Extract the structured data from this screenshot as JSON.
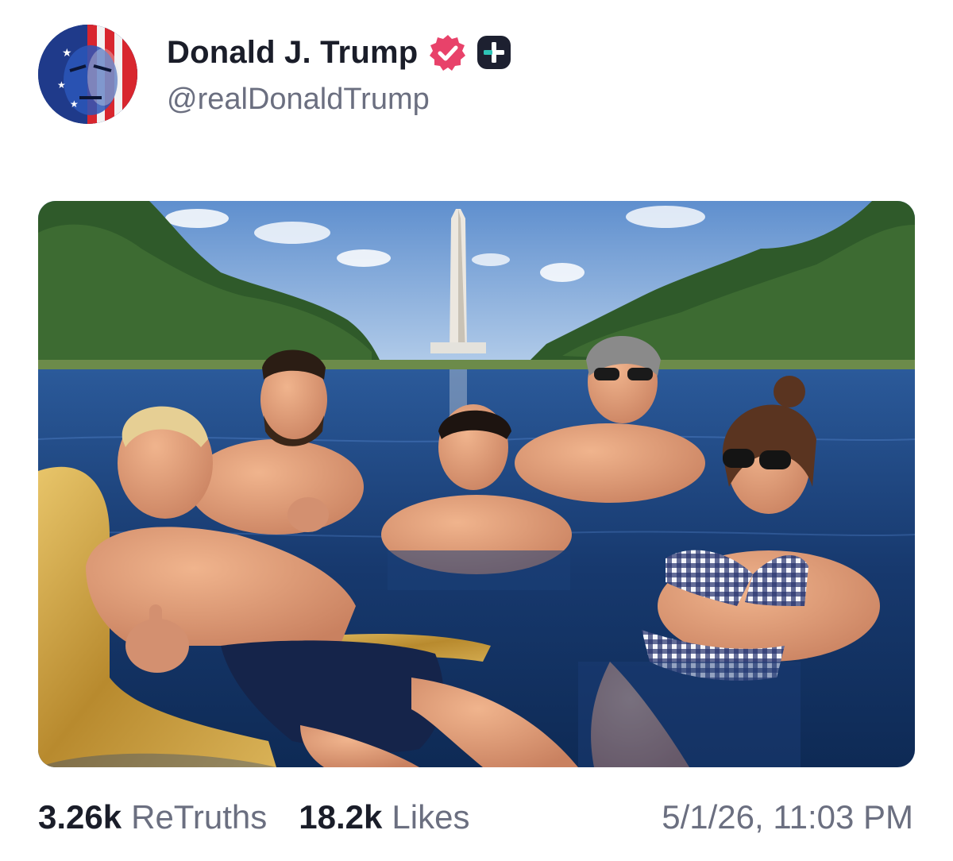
{
  "post": {
    "display_name": "Donald J. Trump",
    "handle": "@realDonaldTrump",
    "avatar_icon": "flag-portrait-avatar",
    "verified_icon": "verified-badge-icon",
    "verified_color": "#e8426a",
    "plus_icon": "plus-badge-icon",
    "image_alt": "Five people swimming in the Lincoln Memorial Reflecting Pool with the Washington Monument in the background",
    "retruths_count": "3.26k",
    "retruths_label": "ReTruths",
    "likes_count": "18.2k",
    "likes_label": "Likes",
    "timestamp": "5/1/26, 11:03 PM"
  }
}
